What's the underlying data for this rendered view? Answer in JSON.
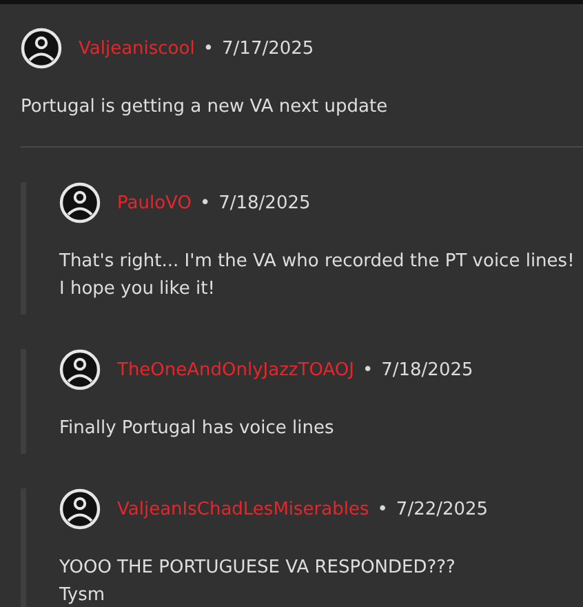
{
  "comment": {
    "author": "Valjeaniscool",
    "separator": "•",
    "date": "7/17/2025",
    "body": "Portugal is getting a new VA next update"
  },
  "replies": [
    {
      "author": "PauloVO",
      "separator": "•",
      "date": "7/18/2025",
      "body": "That's right... I'm the VA who recorded the PT voice lines!\nI hope you like it!"
    },
    {
      "author": "TheOneAndOnlyJazzTOAOJ",
      "separator": "•",
      "date": "7/18/2025",
      "body": "Finally Portugal has voice lines"
    },
    {
      "author": "ValjeanIsChadLesMiserables",
      "separator": "•",
      "date": "7/22/2025",
      "body": "YOOO THE PORTUGUESE VA RESPONDED???\nTysm"
    }
  ]
}
